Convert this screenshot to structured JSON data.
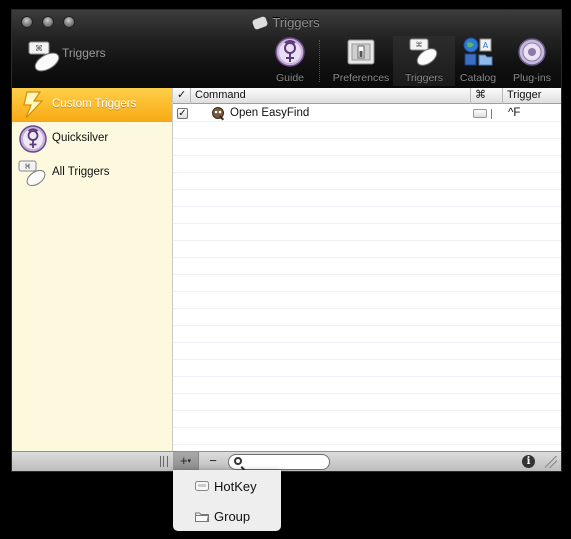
{
  "window": {
    "title": "Triggers",
    "header_title": "Triggers"
  },
  "toolbar": {
    "items": [
      {
        "label": "Guide",
        "icon": "quicksilver-icon"
      },
      {
        "label": "Preferences",
        "icon": "preferences-switch-icon"
      },
      {
        "label": "Triggers",
        "icon": "triggers-icon",
        "active": true
      },
      {
        "label": "Catalog",
        "icon": "catalog-icon"
      },
      {
        "label": "Plug-ins",
        "icon": "plugins-icon"
      }
    ]
  },
  "sidebar": {
    "items": [
      {
        "label": "Custom Triggers",
        "icon": "lightning-icon",
        "selected": true
      },
      {
        "label": "Quicksilver",
        "icon": "quicksilver-icon"
      },
      {
        "label": "All Triggers",
        "icon": "triggers-icon"
      }
    ]
  },
  "table": {
    "columns": {
      "enabled": "✓",
      "command": "Command",
      "modifier": "⌘",
      "trigger": "Trigger"
    },
    "rows": [
      {
        "enabled": true,
        "command": "Open EasyFind",
        "trigger": "^F"
      }
    ]
  },
  "bottom_bar": {
    "add_label": "+",
    "add_arrow": "▾",
    "remove_label": "−",
    "search_placeholder": "",
    "info_label": "i"
  },
  "menu": {
    "items": [
      {
        "label": "HotKey",
        "icon": "keyboard-icon"
      },
      {
        "label": "Group",
        "icon": "folder-icon"
      }
    ]
  },
  "colors": {
    "selection": "#f7a913",
    "sidebar_bg": "#fdf9df",
    "toolbar_bg": "#111111"
  }
}
